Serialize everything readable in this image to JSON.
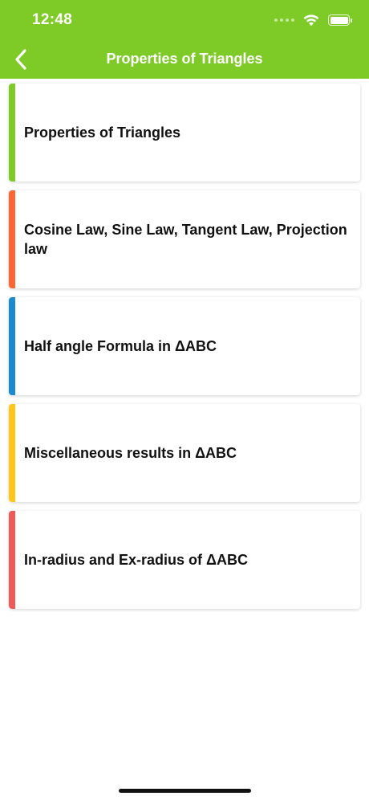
{
  "status_bar": {
    "time": "12:48"
  },
  "nav": {
    "title": "Properties of Triangles",
    "back_icon": "chevron-left-icon"
  },
  "colors": {
    "header_green": "#7ecb28",
    "accent_green": "#7ecb28",
    "accent_orange": "#ff6433",
    "accent_blue": "#1a8ad1",
    "accent_yellow": "#ffc61a",
    "accent_red": "#f25a5a"
  },
  "items": [
    {
      "label": "Properties of Triangles",
      "accent": "#7ecb28"
    },
    {
      "label": "Cosine Law, Sine Law, Tangent Law, Projection law",
      "accent": "#ff6433"
    },
    {
      "label": "Half angle Formula in ΔABC",
      "accent": "#1a8ad1"
    },
    {
      "label": "Miscellaneous results in ΔABC",
      "accent": "#ffc61a"
    },
    {
      "label": "In-radius and Ex-radius of ΔABC",
      "accent": "#f25a5a"
    }
  ]
}
